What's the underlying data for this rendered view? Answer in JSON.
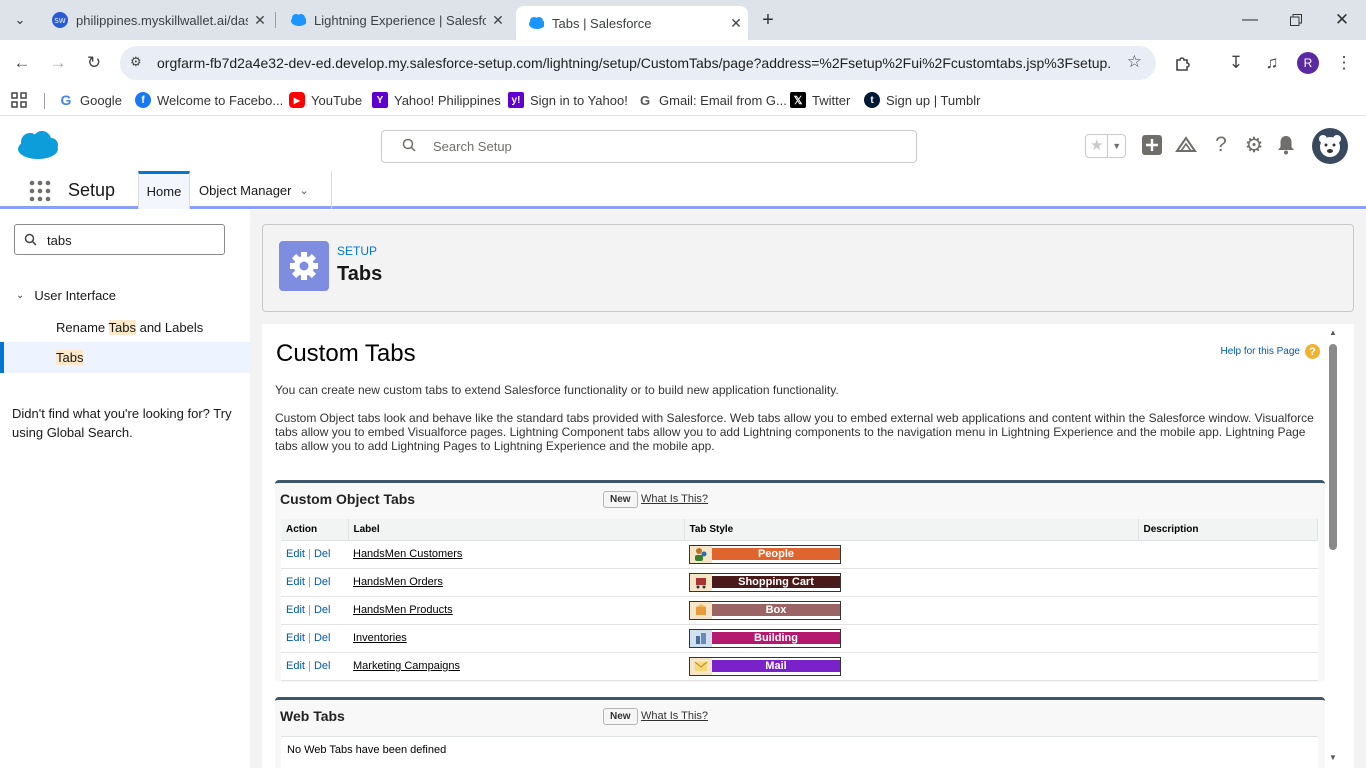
{
  "browser": {
    "tabs": [
      {
        "title": "philippines.myskillwallet.ai/dash",
        "favicon": "skillwallet-icon"
      },
      {
        "title": "Lightning Experience | Salesforce",
        "favicon": "salesforce-cloud-icon"
      },
      {
        "title": "Tabs | Salesforce",
        "favicon": "salesforce-cloud-icon",
        "active": true
      }
    ],
    "url": "orgfarm-fb7d2a4e32-dev-ed.develop.my.salesforce-setup.com/lightning/setup/CustomTabs/page?address=%2Fsetup%2Fui%2Fcustomtabs.jsp%3Fsetup...",
    "profile_initial": "R",
    "bookmarks": [
      {
        "label": "Google"
      },
      {
        "label": "Welcome to Facebo..."
      },
      {
        "label": "YouTube"
      },
      {
        "label": "Yahoo! Philippines"
      },
      {
        "label": "Sign in to Yahoo!"
      },
      {
        "label": "Gmail: Email from G..."
      },
      {
        "label": "Twitter"
      },
      {
        "label": "Sign up | Tumblr"
      }
    ]
  },
  "header": {
    "search_placeholder": "Search Setup"
  },
  "nav": {
    "app_name": "Setup",
    "tabs": [
      {
        "label": "Home"
      },
      {
        "label": "Object Manager"
      }
    ]
  },
  "sidebar": {
    "quickfind_value": "tabs",
    "section": "User Interface",
    "items": [
      {
        "pre": "Rename ",
        "hl": "Tabs",
        "post": " and Labels"
      },
      {
        "pre": "",
        "hl": "Tabs",
        "post": ""
      }
    ],
    "help_text": "Didn't find what you're looking for? Try using Global Search."
  },
  "pagehead": {
    "eyebrow": "SETUP",
    "title": "Tabs"
  },
  "content": {
    "title": "Custom Tabs",
    "help_link": "Help for this Page",
    "intro": "You can create new custom tabs to extend Salesforce functionality or to build new application functionality.",
    "desc": "Custom Object tabs look and behave like the standard tabs provided with Salesforce. Web tabs allow you to embed external web applications and content within the Salesforce window. Visualforce tabs allow you to embed Visualforce pages. Lightning Component tabs allow you to add Lightning components to the navigation menu in Lightning Experience and the mobile app. Lightning Page tabs allow you to add Lightning Pages to Lightning Experience and the mobile app.",
    "custom_object_tabs": {
      "heading": "Custom Object Tabs",
      "new_label": "New",
      "what_label": "What Is This?",
      "columns": [
        "Action",
        "Label",
        "Tab Style",
        "Description"
      ],
      "edit_label": "Edit",
      "del_label": "Del",
      "rows": [
        {
          "label": "HandsMen Customers",
          "style": "People",
          "color": "#e0642d",
          "icon": "people-icon"
        },
        {
          "label": "HandsMen Orders",
          "style": "Shopping Cart",
          "color": "#4a1a1a",
          "icon": "cart-icon"
        },
        {
          "label": "HandsMen Products",
          "style": "Box",
          "color": "#9b6464",
          "icon": "box-icon"
        },
        {
          "label": "Inventories",
          "style": "Building",
          "color": "#b5196e",
          "icon": "building-icon"
        },
        {
          "label": "Marketing Campaigns",
          "style": "Mail",
          "color": "#7a22c9",
          "icon": "mail-icon"
        }
      ]
    },
    "web_tabs": {
      "heading": "Web Tabs",
      "new_label": "New",
      "what_label": "What Is This?",
      "empty": "No Web Tabs have been defined"
    }
  }
}
